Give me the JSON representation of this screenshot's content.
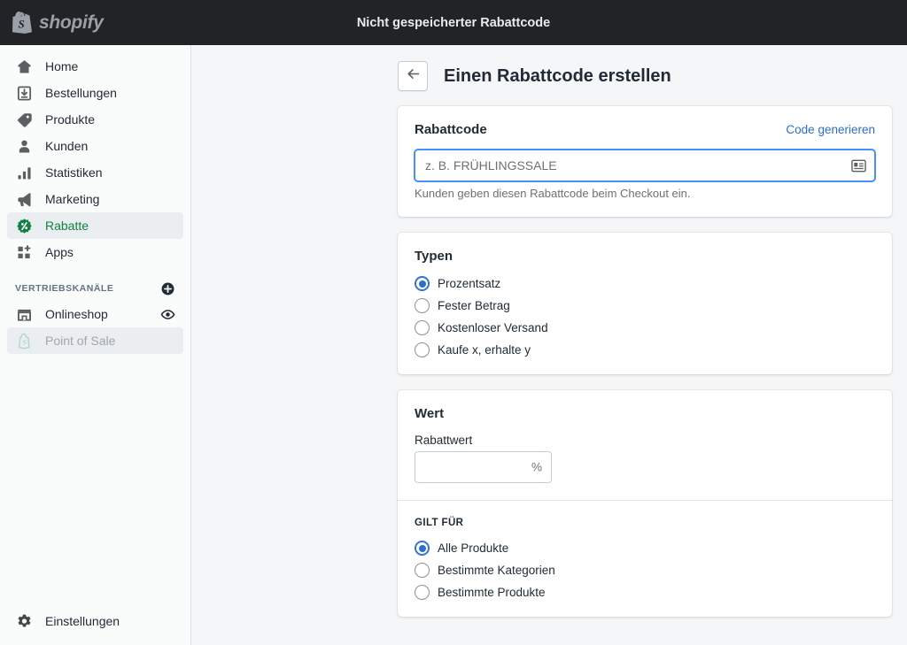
{
  "topbar": {
    "brand_name": "shopify",
    "brand_icon": "shopify-bag-icon",
    "title": "Nicht gespeicherter Rabattcode"
  },
  "sidebar": {
    "primary_items": [
      {
        "label": "Home",
        "icon": "home-icon",
        "active": false
      },
      {
        "label": "Bestellungen",
        "icon": "orders-icon",
        "active": false
      },
      {
        "label": "Produkte",
        "icon": "tag-icon",
        "active": false
      },
      {
        "label": "Kunden",
        "icon": "person-icon",
        "active": false
      },
      {
        "label": "Statistiken",
        "icon": "bar-chart-icon",
        "active": false
      },
      {
        "label": "Marketing",
        "icon": "megaphone-icon",
        "active": false
      },
      {
        "label": "Rabatte",
        "icon": "discount-icon",
        "active": true
      },
      {
        "label": "Apps",
        "icon": "apps-icon",
        "active": false
      }
    ],
    "channels": {
      "heading": "VERTRIEBSKANÄLE",
      "add_icon": "plus-circle-icon",
      "items": [
        {
          "label": "Onlineshop",
          "icon": "storefront-icon",
          "trailing_icon": "eye-icon",
          "disabled": false
        },
        {
          "label": "Point of Sale",
          "icon": "shopify-bag-outline-icon",
          "trailing_icon": "",
          "disabled": true
        }
      ]
    },
    "settings": {
      "label": "Einstellungen",
      "icon": "gear-icon"
    }
  },
  "page": {
    "back_icon": "arrow-left-icon",
    "title": "Einen Rabattcode erstellen"
  },
  "discount_code_card": {
    "title": "Rabattcode",
    "generate_link": "Code generieren",
    "input": {
      "value": "",
      "placeholder": "z. B. FRÜHLINGSSALE",
      "focused": true,
      "suffix_icon": "id-card-icon"
    },
    "help_text": "Kunden geben diesen Rabattcode beim Checkout ein."
  },
  "types_card": {
    "title": "Typen",
    "selected": "Prozentsatz",
    "options": [
      {
        "label": "Prozentsatz",
        "checked": true
      },
      {
        "label": "Fester Betrag",
        "checked": false
      },
      {
        "label": "Kostenloser Versand",
        "checked": false
      },
      {
        "label": "Kaufe x, erhalte y",
        "checked": false
      }
    ]
  },
  "value_card": {
    "title": "Wert",
    "amount_label": "Rabattwert",
    "amount_value": "",
    "amount_suffix": "%",
    "applies_to": {
      "heading": "GILT FÜR",
      "selected": "Alle Produkte",
      "options": [
        {
          "label": "Alle Produkte",
          "checked": true
        },
        {
          "label": "Bestimmte Kategorien",
          "checked": false
        },
        {
          "label": "Bestimmte Produkte",
          "checked": false
        }
      ]
    }
  },
  "colors": {
    "topbar_bg": "#222326",
    "sidebar_bg": "#fafbfb",
    "page_bg": "#f4f6f8",
    "accent_link": "#2c6ecb",
    "accent_green": "#108043",
    "focus_border": "#458fff"
  }
}
